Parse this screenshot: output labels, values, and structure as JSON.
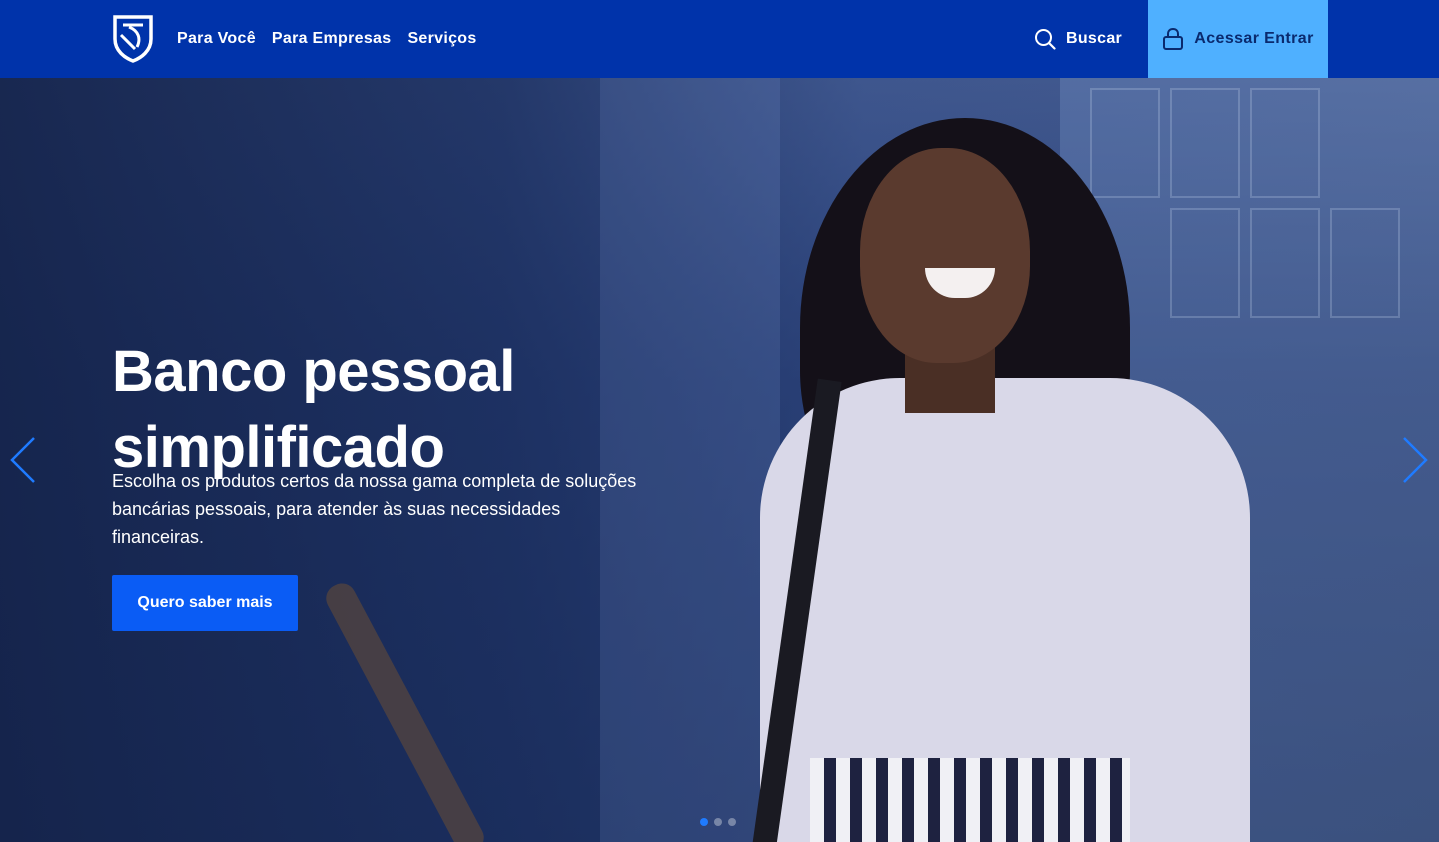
{
  "header": {
    "nav": [
      "Para Você",
      "Para Empresas",
      "Serviços"
    ],
    "search_label": "Buscar",
    "login_label": "Acessar Entrar",
    "colors": {
      "bar": "#0033aa",
      "login_bg": "#4fb0ff"
    }
  },
  "hero": {
    "title_line1": "Banco pessoal",
    "title_line2": "simplificado",
    "subtitle": "Escolha os produtos certos da nossa gama completa de soluções bancárias pessoais, para atender às suas necessidades financeiras.",
    "cta_label": "Quero saber mais",
    "cta_color": "#0a5cf5",
    "carousel": {
      "slides": 3,
      "active": 1
    }
  },
  "icons": {
    "logo": "shield-logo-icon",
    "search": "search-icon",
    "lock": "lock-icon",
    "prev": "chevron-left-icon",
    "next": "chevron-right-icon"
  }
}
